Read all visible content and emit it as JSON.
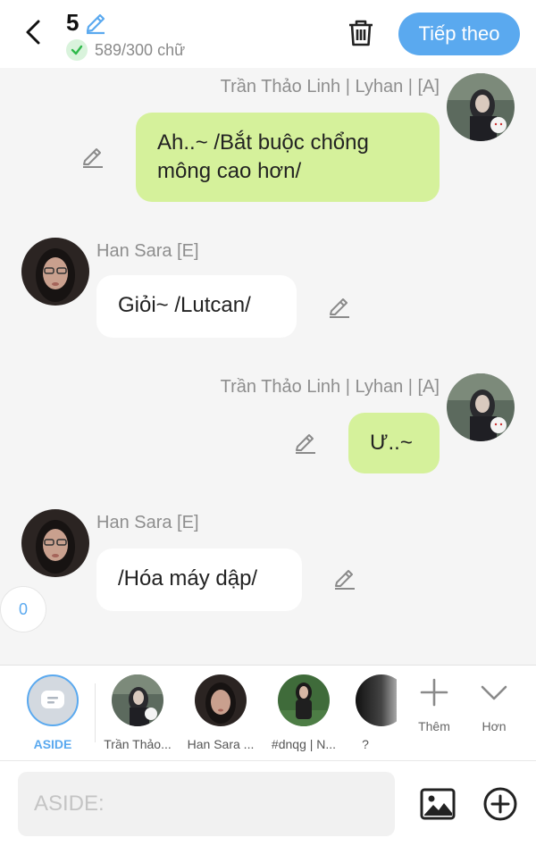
{
  "header": {
    "episode_number": "5",
    "word_count": "589/300 chữ",
    "next_label": "Tiếp theo"
  },
  "messages": [
    {
      "sender": "Trần Thảo Linh | Lyhan | [A]",
      "text": "Ah..~ /Bắt buộc chổng mông cao hơn/",
      "side": "right"
    },
    {
      "sender": "Han Sara [E]",
      "text": "Giỏi~ /Lutcan/",
      "side": "left"
    },
    {
      "sender": "Trần Thảo Linh | Lyhan | [A]",
      "text": "Ư..~",
      "side": "right"
    },
    {
      "sender": "Han Sara [E]",
      "text": "/Hóa máy dập/",
      "side": "left"
    }
  ],
  "counter": "0",
  "characters": {
    "aside": "ASIDE",
    "items": [
      "Trần Thảo...",
      "Han Sara ...",
      "#dnqg | N...",
      "?"
    ],
    "add_label": "Thêm",
    "more_label": "Hơn"
  },
  "input": {
    "placeholder": "ASIDE:"
  },
  "colors": {
    "accent": "#5aa9ef",
    "right_bubble": "#d5f19b",
    "left_bubble": "#ffffff",
    "check": "#2fb94b"
  }
}
